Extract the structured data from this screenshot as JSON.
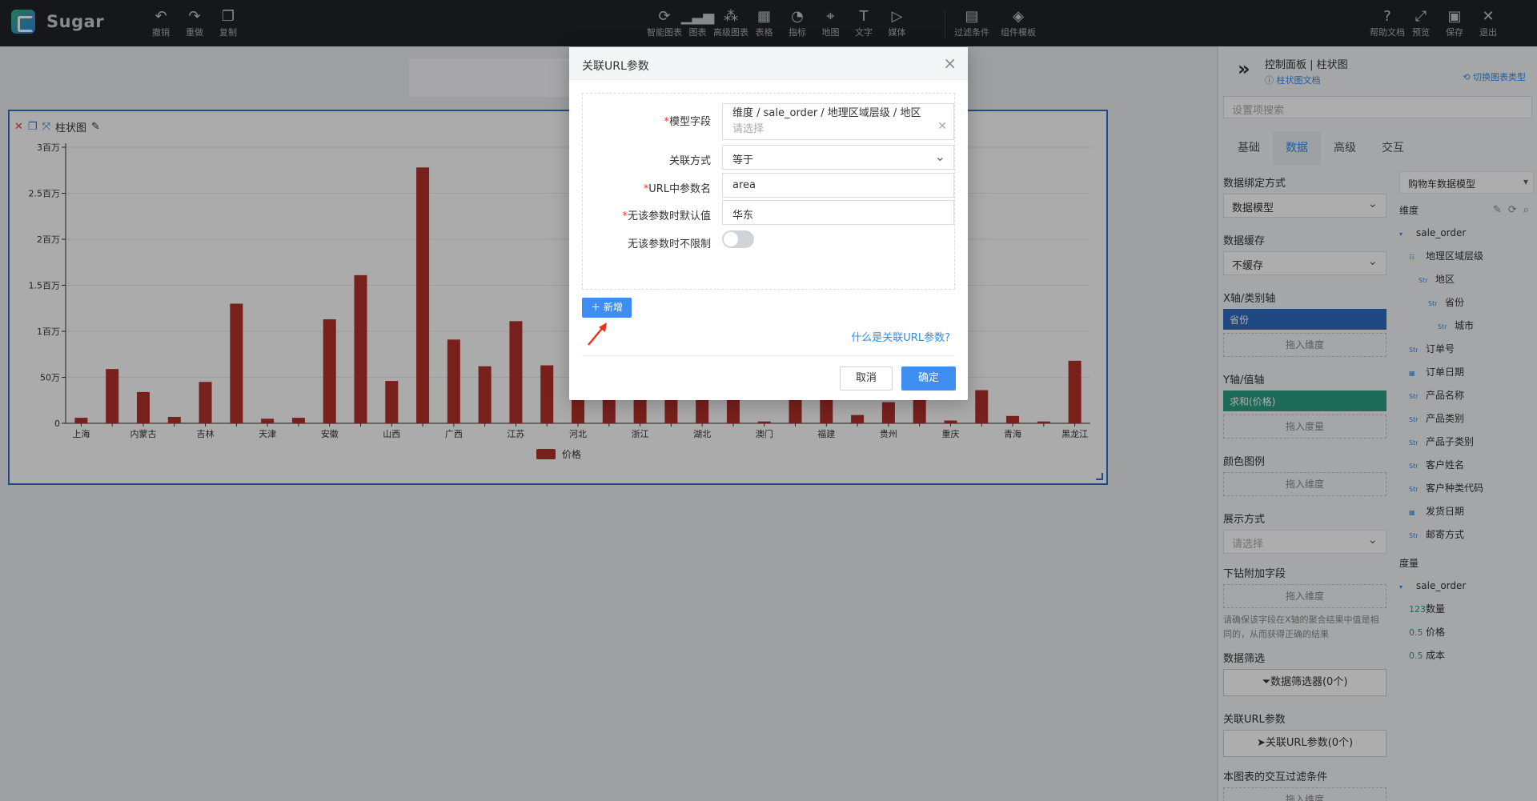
{
  "app": {
    "name": "Sugar"
  },
  "toolbar": {
    "left": [
      {
        "icon": "undo-icon",
        "glyph": "↶",
        "label": "撤销"
      },
      {
        "icon": "redo-icon",
        "glyph": "↷",
        "label": "重做"
      },
      {
        "icon": "copy-icon",
        "glyph": "❐",
        "label": "复制"
      }
    ],
    "center": [
      {
        "icon": "smart-chart-icon",
        "glyph": "⟳",
        "label": "智能图表"
      },
      {
        "icon": "chart-icon",
        "glyph": "▁▃▅",
        "label": "图表"
      },
      {
        "icon": "advanced-chart-icon",
        "glyph": "⁂",
        "label": "高级图表"
      },
      {
        "icon": "table-icon",
        "glyph": "▦",
        "label": "表格"
      },
      {
        "icon": "indicator-icon",
        "glyph": "◔",
        "label": "指标"
      },
      {
        "icon": "map-icon",
        "glyph": "⌖",
        "label": "地图"
      },
      {
        "icon": "text-icon",
        "glyph": "T",
        "label": "文字"
      },
      {
        "icon": "media-icon",
        "glyph": "▷",
        "label": "媒体"
      }
    ],
    "center2": [
      {
        "icon": "filter-icon",
        "glyph": "▤",
        "label": "过滤条件"
      },
      {
        "icon": "template-icon",
        "glyph": "◈",
        "label": "组件模板"
      }
    ],
    "right": [
      {
        "icon": "help-icon",
        "glyph": "?",
        "label": "帮助文档"
      },
      {
        "icon": "preview-icon",
        "glyph": "⤢",
        "label": "预览"
      },
      {
        "icon": "save-icon",
        "glyph": "▣",
        "label": "保存"
      },
      {
        "icon": "exit-icon",
        "glyph": "✕",
        "label": "退出"
      }
    ]
  },
  "chart_widget": {
    "title": "柱状图",
    "legend_label": "价格"
  },
  "chart_data": {
    "type": "bar",
    "title": "",
    "xlabel": "",
    "ylabel": "",
    "ylim": [
      0,
      3000000
    ],
    "yticks": [
      {
        "value": 0,
        "label": "0"
      },
      {
        "value": 500000,
        "label": "50万"
      },
      {
        "value": 1000000,
        "label": "1百万"
      },
      {
        "value": 1500000,
        "label": "1.5百万"
      },
      {
        "value": 2000000,
        "label": "2百万"
      },
      {
        "value": 2500000,
        "label": "2.5百万"
      },
      {
        "value": 3000000,
        "label": "3百万"
      }
    ],
    "categories": [
      "上海",
      "",
      "内蒙古",
      "",
      "吉林",
      "",
      "天津",
      "",
      "安徽",
      "",
      "山西",
      "",
      "广西",
      "",
      "江苏",
      "",
      "河北",
      "",
      "浙江",
      "",
      "湖北",
      "",
      "澳门",
      "",
      "福建",
      "",
      "贵州",
      "",
      "重庆",
      "",
      "青海",
      "",
      "黑龙江"
    ],
    "series": [
      {
        "name": "价格",
        "color": "#b0302a",
        "values": [
          60000,
          590000,
          340000,
          70000,
          450000,
          1300000,
          50000,
          60000,
          1130000,
          1610000,
          460000,
          2780000,
          910000,
          620000,
          1110000,
          630000,
          900000,
          1000000,
          950000,
          980000,
          970000,
          1100000,
          20000,
          350000,
          700000,
          90000,
          230000,
          1000000,
          30000,
          360000,
          80000,
          20000,
          680000
        ]
      }
    ]
  },
  "dialog": {
    "title": "关联URL参数",
    "fields": {
      "model_field_label": "模型字段",
      "model_field_path": "维度 / sale_order / 地理区域层级 / 地区",
      "model_field_placeholder": "请选择",
      "relation_label": "关联方式",
      "relation_value": "等于",
      "param_name_label": "URL中参数名",
      "param_name_value": "area",
      "default_label": "无该参数时默认值",
      "default_value": "华东",
      "no_limit_label": "无该参数时不限制"
    },
    "add_label": "新增",
    "help_link": "什么是关联URL参数?",
    "cancel_label": "取消",
    "ok_label": "确定"
  },
  "panel": {
    "title": "控制面板 | 柱状图",
    "doc_link": "柱状图文档",
    "switch_link": "切换图表类型",
    "search_placeholder": "设置项搜索",
    "tabs": [
      "基础",
      "数据",
      "高级",
      "交互"
    ],
    "active_tab": "数据",
    "data_binding_label": "数据绑定方式",
    "data_binding_value": "数据模型",
    "cache_label": "数据缓存",
    "cache_value": "不缓存",
    "x_axis_label": "X轴/类别轴",
    "x_axis_pill": "省份",
    "drop_dimension": "拖入维度",
    "y_axis_label": "Y轴/值轴",
    "y_axis_pill": "求和(价格)",
    "drop_measure": "拖入度量",
    "color_legend_label": "颜色图例",
    "display_label": "展示方式",
    "display_placeholder": "请选择",
    "drill_label": "下钻附加字段",
    "drill_note": "请确保该字段在X轴的聚合结果中值是相同的，从而获得正确的结果",
    "data_filter_label": "数据筛选",
    "data_filter_button": "数据筛选器(0个)",
    "url_param_label": "关联URL参数",
    "url_param_button": "关联URL参数(0个)",
    "interaction_label": "本图表的交互过滤条件",
    "model_select": "购物车数据模型",
    "dimension_label": "维度",
    "measure_label": "度量",
    "dimension_tree": [
      {
        "tag": "▾",
        "label": "sale_order",
        "indent": 0
      },
      {
        "tag": "☷",
        "label": "地理区域层级",
        "indent": 1
      },
      {
        "tag": "Str",
        "label": "地区",
        "indent": 2
      },
      {
        "tag": "Str",
        "label": "省份",
        "indent": 3
      },
      {
        "tag": "Str",
        "label": "城市",
        "indent": 4
      },
      {
        "tag": "Str",
        "label": "订单号",
        "indent": 1
      },
      {
        "tag": "▦",
        "label": "订单日期",
        "indent": 1
      },
      {
        "tag": "Str",
        "label": "产品名称",
        "indent": 1
      },
      {
        "tag": "Str",
        "label": "产品类别",
        "indent": 1
      },
      {
        "tag": "Str",
        "label": "产品子类别",
        "indent": 1
      },
      {
        "tag": "Str",
        "label": "客户姓名",
        "indent": 1
      },
      {
        "tag": "Str",
        "label": "客户种类代码",
        "indent": 1
      },
      {
        "tag": "▦",
        "label": "发货日期",
        "indent": 1
      },
      {
        "tag": "Str",
        "label": "邮寄方式",
        "indent": 1
      }
    ],
    "measure_tree": [
      {
        "tag": "▾",
        "label": "sale_order",
        "indent": 0
      },
      {
        "tag": "123",
        "label": "数量",
        "indent": 1
      },
      {
        "tag": "0.5",
        "label": "价格",
        "indent": 1
      },
      {
        "tag": "0.5",
        "label": "成本",
        "indent": 1
      }
    ]
  }
}
